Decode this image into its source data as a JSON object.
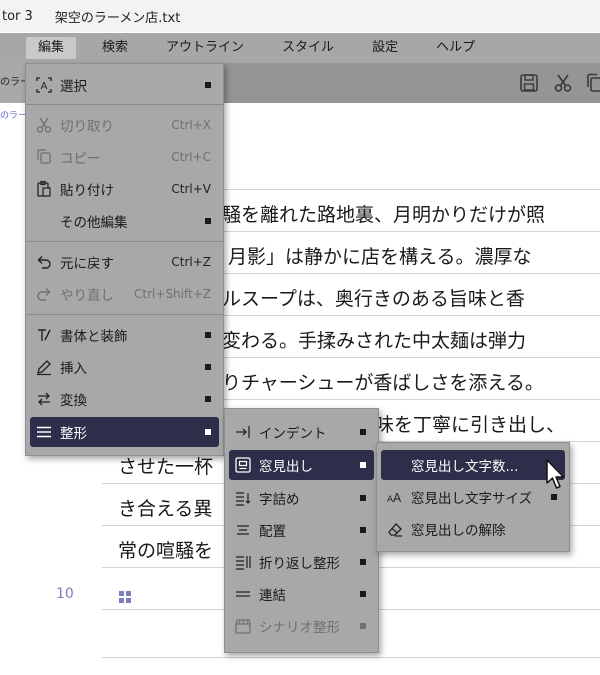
{
  "window": {
    "app_title": "tor 3",
    "file_title": "架空のラーメン店.txt"
  },
  "menubar": {
    "items": [
      "編集",
      "検索",
      "アウトライン",
      "スタイル",
      "設定",
      "ヘルプ"
    ]
  },
  "tab": {
    "label": "のラー"
  },
  "breadcrumb": "のラー",
  "edit_menu": {
    "items": [
      {
        "label": "選択",
        "shortcut": ""
      },
      {
        "label": "切り取り",
        "shortcut": "Ctrl+X"
      },
      {
        "label": "コピー",
        "shortcut": "Ctrl+C"
      },
      {
        "label": "貼り付け",
        "shortcut": "Ctrl+V"
      },
      {
        "label": "その他編集",
        "shortcut": ""
      },
      {
        "label": "元に戻す",
        "shortcut": "Ctrl+Z"
      },
      {
        "label": "やり直し",
        "shortcut": "Ctrl+Shift+Z"
      },
      {
        "label": "書体と装飾",
        "shortcut": ""
      },
      {
        "label": "挿入",
        "shortcut": ""
      },
      {
        "label": "変換",
        "shortcut": ""
      },
      {
        "label": "整形",
        "shortcut": ""
      }
    ]
  },
  "format_menu": {
    "items": [
      {
        "label": "インデント"
      },
      {
        "label": "窓見出し"
      },
      {
        "label": "字詰め"
      },
      {
        "label": "配置"
      },
      {
        "label": "折り返し整形"
      },
      {
        "label": "連結"
      },
      {
        "label": "シナリオ整形"
      }
    ]
  },
  "heading_menu": {
    "items": [
      {
        "label": "窓見出し文字数..."
      },
      {
        "label": "窓見出し文字サイズ"
      },
      {
        "label": "窓見出しの解除"
      }
    ]
  },
  "document": {
    "lines": [
      "喧騒を離れた路地裏、月明かりだけが照",
      "屋 月影」は静かに店を構える。濃厚な",
      "ブルスープは、奥行きのある旨味と香",
      "が変わる。手揉みされた中太麺は弾力",
      "切りチャーシューが香ばしさを添える。",
      "味を丁寧に引き出し、",
      "させた一杯",
      "き合える異",
      "常の喧騒を"
    ],
    "line_number": "10"
  },
  "colors": {
    "selected_bg": "#2d2f4a",
    "menu_bg": "#a8a8ab",
    "line_number": "#7b7fc2"
  }
}
